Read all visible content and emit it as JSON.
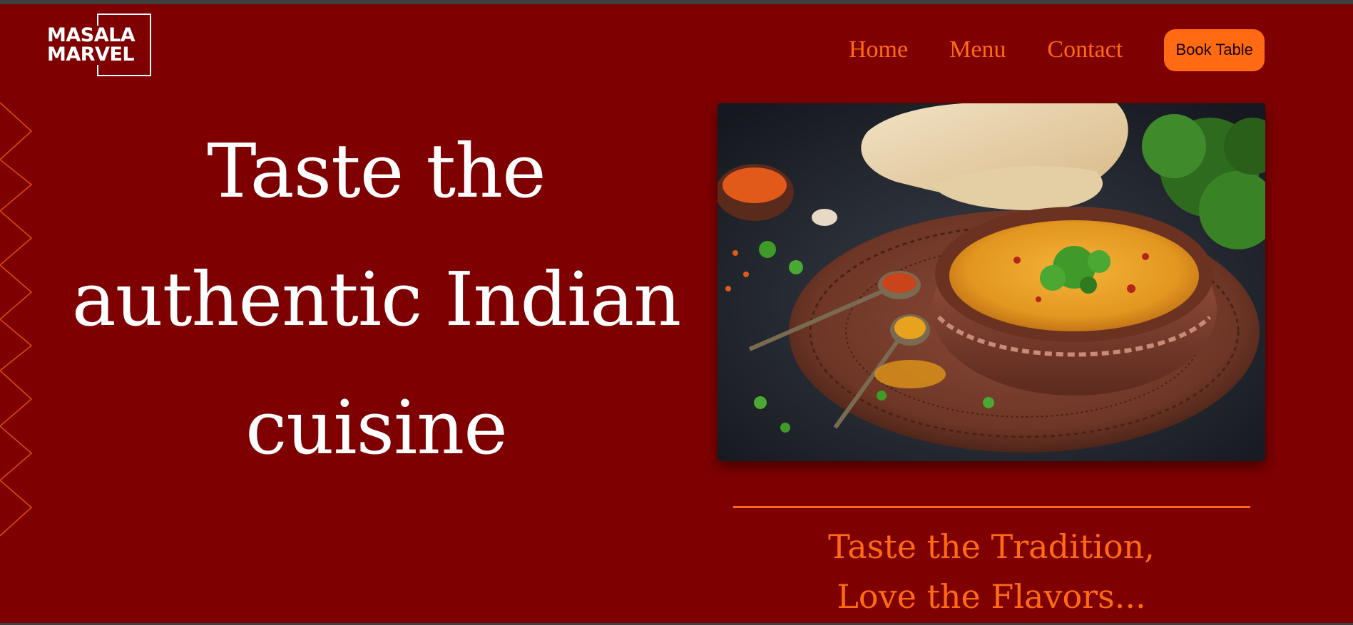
{
  "brand": {
    "logo_line1": "MASALA",
    "logo_line2": "MARVEL"
  },
  "nav": {
    "items": [
      {
        "label": "Home"
      },
      {
        "label": "Menu"
      },
      {
        "label": "Contact"
      }
    ],
    "cta_label": "Book Table"
  },
  "hero": {
    "title": "Taste the authentic Indian cuisine",
    "image_alt": "Bowl of Indian dal with naan, spices and cilantro",
    "tagline_line1": "Taste the Tradition,",
    "tagline_line2": "Love the Flavors..."
  },
  "colors": {
    "background": "#7e0000",
    "accent": "#ff6a13",
    "text": "#ffffff"
  }
}
